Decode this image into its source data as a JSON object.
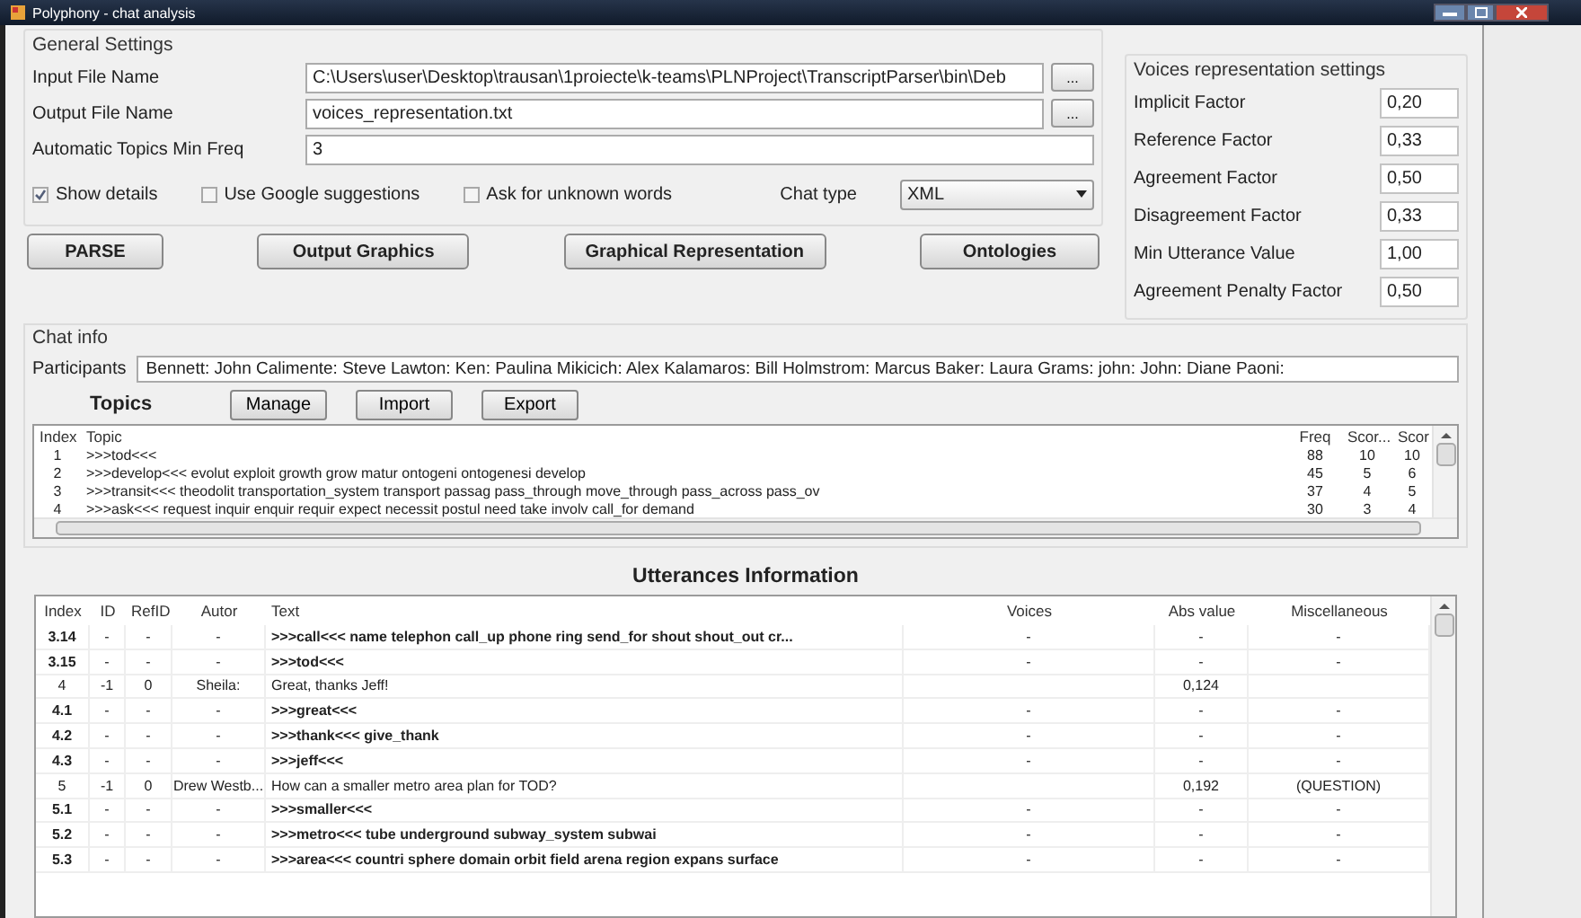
{
  "window": {
    "title": "Polyphony - chat analysis"
  },
  "general_settings": {
    "title": "General Settings",
    "fields": [
      {
        "label": "Input File Name",
        "value": "C:\\Users\\user\\Desktop\\trausan\\1proiecte\\k-teams\\PLNProject\\TranscriptParser\\bin\\Deb",
        "browse": "..."
      },
      {
        "label": "Output File Name",
        "value": "voices_representation.txt",
        "browse": "..."
      },
      {
        "label": "Automatic Topics Min Freq",
        "value": "3"
      }
    ],
    "checkboxes": [
      {
        "label": "Show details",
        "checked": true
      },
      {
        "label": "Use Google suggestions",
        "checked": false
      },
      {
        "label": "Ask for unknown words",
        "checked": false
      }
    ],
    "chat_type": {
      "label": "Chat type",
      "value": "XML"
    }
  },
  "buttons": [
    "PARSE",
    "Output Graphics",
    "Graphical Representation",
    "Ontologies"
  ],
  "voices_settings": {
    "title": "Voices representation settings",
    "fields": [
      {
        "label": "Implicit Factor",
        "value": "0,20"
      },
      {
        "label": "Reference Factor",
        "value": "0,33"
      },
      {
        "label": "Agreement Factor",
        "value": "0,50"
      },
      {
        "label": "Disagreement Factor",
        "value": "0,33"
      },
      {
        "label": "Min Utterance Value",
        "value": "1,00"
      },
      {
        "label": "Agreement Penalty Factor",
        "value": "0,50"
      }
    ]
  },
  "chat_info": {
    "title": "Chat info",
    "participants_label": "Participants",
    "participants": "Bennett: John Calimente: Steve Lawton: Ken: Paulina Mikicich: Alex Kalamaros: Bill Holmstrom: Marcus Baker: Laura Grams: john: John: Diane Paoni:"
  },
  "topics": {
    "title": "Topics",
    "buttons": [
      "Manage",
      "Import",
      "Export"
    ],
    "columns": [
      "Index",
      "Topic",
      "Freq",
      "Scor...",
      "Scor"
    ],
    "rows": [
      [
        "1",
        ">>>tod<<<",
        "88",
        "10",
        "10"
      ],
      [
        "2",
        ">>>develop<<< evolut exploit growth grow matur ontogeni ontogenesi develop",
        "45",
        "5",
        "6"
      ],
      [
        "3",
        ">>>transit<<< theodolit transportation_system transport passag pass_through move_through pass_across pass_ov",
        "37",
        "4",
        "5"
      ],
      [
        "4",
        ">>>ask<<< request inquir enquir requir expect necessit postul need take involv call_for demand",
        "30",
        "3",
        "4"
      ]
    ]
  },
  "utterances": {
    "title": "Utterances Information",
    "columns": [
      "Index",
      "ID",
      "RefID",
      "Autor",
      "Text",
      "Voices",
      "Abs value",
      "Miscellaneous"
    ],
    "rows": [
      {
        "kind": "concept",
        "cells": [
          "3.14",
          "-",
          "-",
          "-",
          ">>>call<<< name telephon call_up phone ring send_for shout shout_out cr...",
          "-",
          "-",
          "-"
        ]
      },
      {
        "kind": "concept",
        "cells": [
          "3.15",
          "-",
          "-",
          "-",
          ">>>tod<<<",
          "-",
          "-",
          "-"
        ]
      },
      {
        "kind": "utterance",
        "cells": [
          "4",
          "-1",
          "0",
          "Sheila:",
          "Great, thanks Jeff!",
          "",
          "0,124",
          ""
        ]
      },
      {
        "kind": "concept",
        "cells": [
          "4.1",
          "-",
          "-",
          "-",
          ">>>great<<<",
          "-",
          "-",
          "-"
        ]
      },
      {
        "kind": "concept",
        "cells": [
          "4.2",
          "-",
          "-",
          "-",
          ">>>thank<<< give_thank",
          "-",
          "-",
          "-"
        ]
      },
      {
        "kind": "concept",
        "cells": [
          "4.3",
          "-",
          "-",
          "-",
          ">>>jeff<<<",
          "-",
          "-",
          "-"
        ]
      },
      {
        "kind": "utterance",
        "cells": [
          "5",
          "-1",
          "0",
          "Drew Westb...",
          "How can a smaller metro area plan for TOD?",
          "",
          "0,192",
          "(QUESTION)"
        ]
      },
      {
        "kind": "concept",
        "cells": [
          "5.1",
          "-",
          "-",
          "-",
          ">>>smaller<<<",
          "-",
          "-",
          "-"
        ]
      },
      {
        "kind": "concept",
        "cells": [
          "5.2",
          "-",
          "-",
          "-",
          ">>>metro<<< tube underground subway_system subwai",
          "-",
          "-",
          "-"
        ]
      },
      {
        "kind": "concept",
        "cells": [
          "5.3",
          "-",
          "-",
          "-",
          ">>>area<<< countri sphere domain orbit field arena region expans surface",
          "-",
          "-",
          "-"
        ]
      }
    ]
  }
}
